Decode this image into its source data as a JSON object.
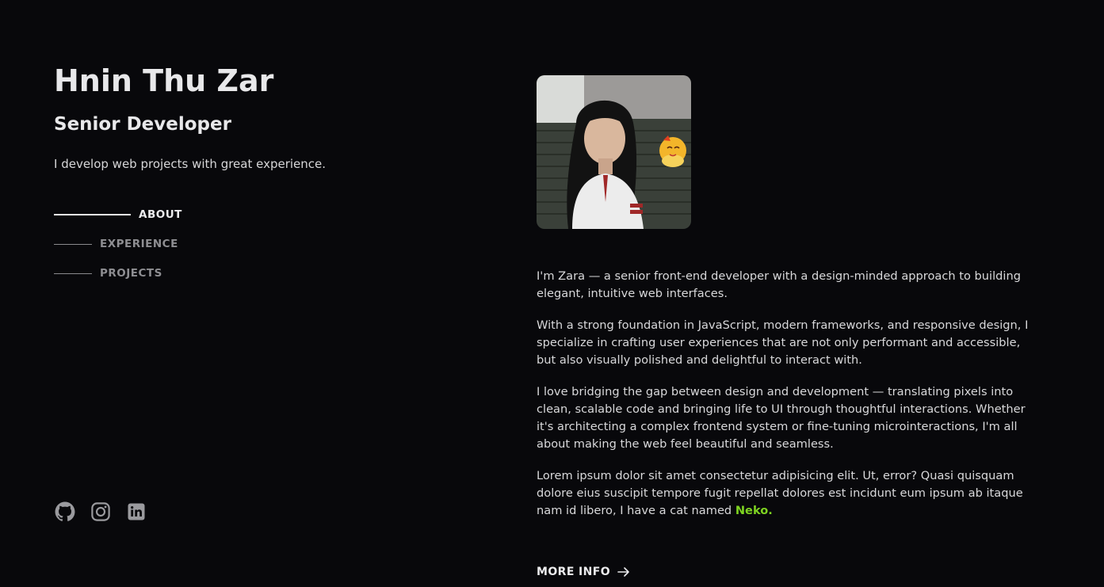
{
  "header": {
    "name": "Hnin Thu Zar",
    "role": "Senior Developer",
    "tagline": "I develop web projects with great experience."
  },
  "nav": {
    "items": [
      {
        "label": "ABOUT",
        "active": true
      },
      {
        "label": "EXPERIENCE",
        "active": false
      },
      {
        "label": "PROJECTS",
        "active": false
      }
    ]
  },
  "socials": {
    "items": [
      {
        "icon": "github-icon"
      },
      {
        "icon": "instagram-icon"
      },
      {
        "icon": "linkedin-icon"
      }
    ],
    "color": "#9a9a9e"
  },
  "about": {
    "paragraphs": [
      "I'm Zara — a senior front-end developer with a design-minded approach to building elegant, intuitive web interfaces.",
      "With a strong foundation in JavaScript, modern frameworks, and responsive design, I specialize in crafting user experiences that are not only performant and accessible, but also visually polished and delightful to interact with.",
      "I love bridging the gap between design and development — translating pixels into clean, scalable code and bringing life to UI through thoughtful interactions. Whether it's architecting a complex frontend system or fine-tuning microinteractions, I'm all about making the web feel beautiful and seamless."
    ],
    "last_paragraph_text": "Lorem ipsum dolor sit amet consectetur adipisicing elit. Ut, error? Quasi quisquam dolore eius suscipit tempore fugit repellat dolores est incidunt eum ipsum ab itaque nam id libero, I have a cat named ",
    "cat_name": "Neko.",
    "accent_color": "#7ed321"
  },
  "more_info": {
    "label": "MORE INFO",
    "icon": "arrow-right-icon"
  },
  "colors": {
    "background": "#08080b",
    "text": "#e8e8ea",
    "muted": "#8e8e92"
  }
}
